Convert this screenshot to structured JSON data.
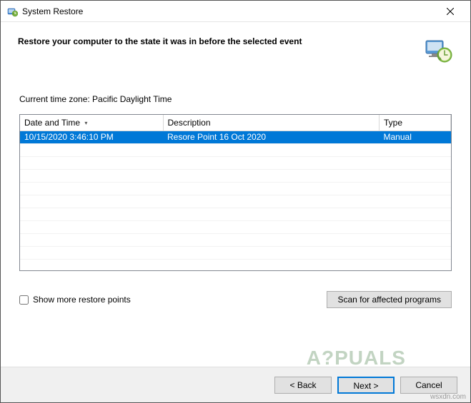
{
  "window": {
    "title": "System Restore",
    "heading": "Restore your computer to the state it was in before the selected event"
  },
  "timezone_label": "Current time zone: Pacific Daylight Time",
  "table": {
    "columns": {
      "date": "Date and Time",
      "desc": "Description",
      "type": "Type"
    },
    "rows": [
      {
        "date": "10/15/2020 3:46:10 PM",
        "desc": "Resore Point 16 Oct 2020",
        "type": "Manual"
      }
    ]
  },
  "controls": {
    "show_more_label": "Show more restore points",
    "scan_button": "Scan for affected programs"
  },
  "footer": {
    "back": "< Back",
    "next": "Next >",
    "cancel": "Cancel"
  },
  "watermark": "A?PUALS",
  "watermark2": "wsxdn.com"
}
